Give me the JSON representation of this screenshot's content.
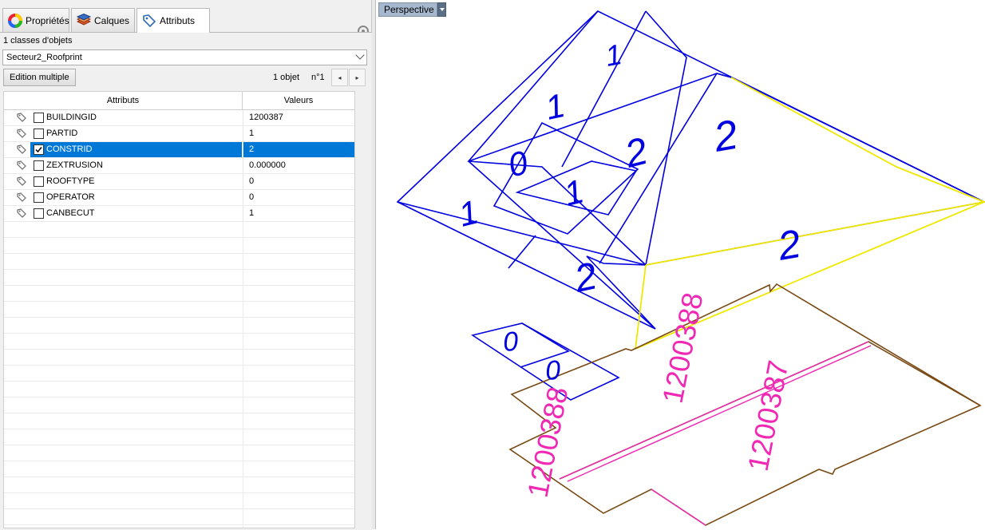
{
  "tabs": {
    "proprietes": "Propriétés",
    "calques": "Calques",
    "attributs": "Attributs"
  },
  "panel": {
    "classes_count": "1 classes d'objets",
    "class_selected": "Secteur2_Roofprint",
    "edit_button": "Edition multiple",
    "object_count": "1 objet",
    "object_index": "n°1",
    "prev_label": "◂",
    "next_label": "▸"
  },
  "grid": {
    "col_attributes": "Attributs",
    "col_values": "Valeurs",
    "rows": [
      {
        "name": "BUILDINGID",
        "value": "1200387",
        "checked": false,
        "selected": false
      },
      {
        "name": "PARTID",
        "value": "1",
        "checked": false,
        "selected": false
      },
      {
        "name": "CONSTRID",
        "value": "2",
        "checked": true,
        "selected": true
      },
      {
        "name": "ZEXTRUSION",
        "value": "0.000000",
        "checked": false,
        "selected": false
      },
      {
        "name": "ROOFTYPE",
        "value": "0",
        "checked": false,
        "selected": false
      },
      {
        "name": "OPERATOR",
        "value": "0",
        "checked": false,
        "selected": false
      },
      {
        "name": "CANBECUT",
        "value": "1",
        "checked": false,
        "selected": false
      }
    ]
  },
  "viewport": {
    "label": "Perspective",
    "blue_labels": [
      "1",
      "1",
      "0",
      "1",
      "2",
      "2",
      "1",
      "2",
      "0",
      "0"
    ],
    "yellow_label": "2",
    "ids": [
      "1200388",
      "1200387",
      "1200388"
    ],
    "colors": {
      "blue": "#0000e0",
      "yellow": "#f0f000",
      "brown": "#7a4a14",
      "magenta": "#f028b4",
      "selection": "#0078d7"
    }
  }
}
